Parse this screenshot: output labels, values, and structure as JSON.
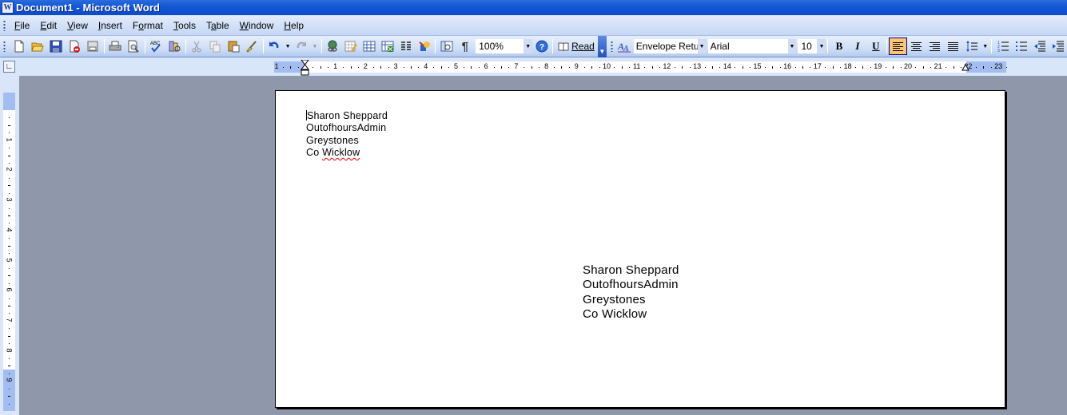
{
  "window": {
    "title": "Document1 - Microsoft Word",
    "app_icon": "word-icon"
  },
  "menubar": {
    "items": [
      {
        "label": "File",
        "mnemonic": "F"
      },
      {
        "label": "Edit",
        "mnemonic": "E"
      },
      {
        "label": "View",
        "mnemonic": "V"
      },
      {
        "label": "Insert",
        "mnemonic": "I"
      },
      {
        "label": "Format",
        "mnemonic": "o"
      },
      {
        "label": "Tools",
        "mnemonic": "T"
      },
      {
        "label": "Table",
        "mnemonic": "a"
      },
      {
        "label": "Window",
        "mnemonic": "W"
      },
      {
        "label": "Help",
        "mnemonic": "H"
      }
    ]
  },
  "standard_toolbar": {
    "buttons": [
      "new-icon",
      "open-icon",
      "save-icon",
      "permission-icon",
      "email-icon",
      "print-icon",
      "print-preview-icon",
      "spelling-icon",
      "research-icon",
      "cut-icon",
      "copy-icon",
      "paste-icon",
      "format-painter-icon",
      "undo-icon",
      "redo-icon",
      "hyperlink-icon",
      "tables-borders-icon",
      "insert-table-icon",
      "insert-excel-icon",
      "columns-icon",
      "drawing-icon",
      "document-map-icon",
      "show-hide-icon",
      "help-icon"
    ],
    "zoom_value": "100%",
    "read_label": "Read"
  },
  "formatting_toolbar": {
    "style_value": "Envelope Return",
    "style_display": "Envelope Retur",
    "font_value": "Arial",
    "size_value": "10",
    "bold_label": "B",
    "italic_label": "I",
    "underline_label": "U",
    "alignment_active": "left"
  },
  "ruler": {
    "horizontal_labels": [
      "1",
      "1",
      "2",
      "3",
      "4",
      "5",
      "6",
      "7",
      "8",
      "9",
      "10",
      "11",
      "12",
      "13",
      "14",
      "15",
      "16",
      "17",
      "18",
      "19",
      "20",
      "21",
      "22",
      "23"
    ],
    "vertical_labels": [
      "1",
      "2",
      "3",
      "4",
      "5",
      "6",
      "7",
      "8",
      "9"
    ],
    "tab_selector": "left-tab"
  },
  "document": {
    "return_address": [
      "Sharon Sheppard",
      "OutofhoursAdmin",
      "Greystones",
      "Co ",
      "Wicklow"
    ],
    "delivery_address": [
      "Sharon Sheppard",
      "OutofhoursAdmin",
      "Greystones",
      "Co Wicklow"
    ],
    "misspelled_word": "Wicklow"
  },
  "colors": {
    "titlebar": "#0a4bc8",
    "toolbar": "#cfdff7",
    "active_button": "#ffc47a",
    "workspace": "#8f98ab",
    "ruler_margin": "#a3bdf0"
  }
}
